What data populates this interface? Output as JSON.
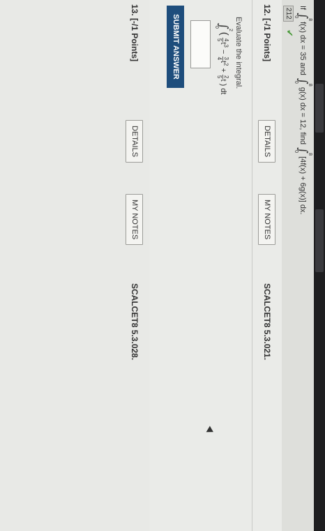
{
  "q11": {
    "if": "If",
    "upper": "8",
    "lower": "0",
    "f_expr": "f(x) dx = 35 and",
    "g_expr": "g(x) dx = 12, find",
    "find_expr": "[4f(x) + 6g(x)] dx.",
    "answer": "212"
  },
  "q12": {
    "points": "12. [-/1 Points]",
    "details_label": "DETAILS",
    "notes_label": "MY NOTES",
    "code": "SCALCET8 5.3.021.",
    "prompt": "Evaluate the integral.",
    "upper": "2",
    "lower": "0",
    "expr": {
      "open": "(",
      "n1": "4",
      "d1": "5",
      "t1": "t",
      "p1": "3",
      "minus": " − ",
      "n2": "3",
      "d2": "4",
      "t2": "t",
      "p2": "2",
      "plus": " + ",
      "n3": "2",
      "d3": "5",
      "t3": "t",
      "close": ") dt"
    },
    "submit_label": "SUBMIT ANSWER"
  },
  "q13": {
    "points": "13. [-/1 Points]",
    "details_label": "DETAILS",
    "notes_label": "MY NOTES",
    "code": "SCALCET8 5.3.028."
  },
  "colors": {
    "submit_bg": "#1e4d7c",
    "check": "#4a9a3a"
  },
  "icons": {
    "check": "checkmark-icon",
    "cursor": "mouse-cursor-icon"
  }
}
